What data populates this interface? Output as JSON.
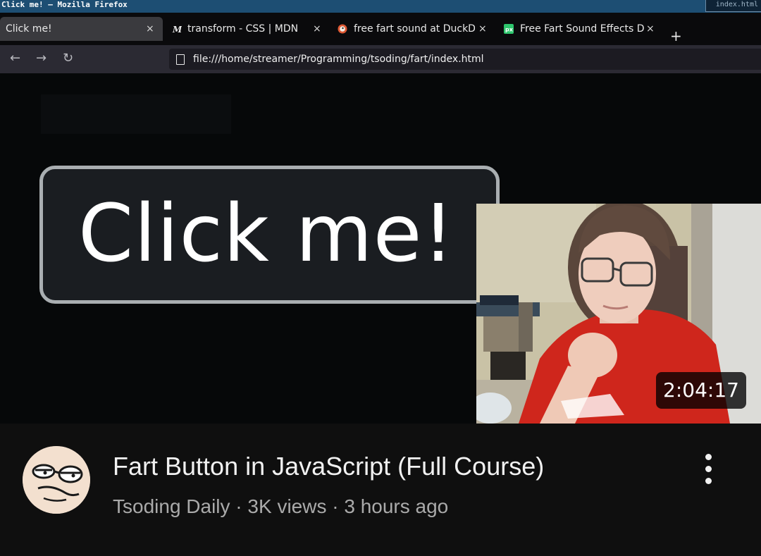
{
  "os": {
    "window_title": "Click me! — Mozilla Firefox",
    "right_snippet": "index.html"
  },
  "browser": {
    "tabs": [
      {
        "label": "Click me!",
        "active": true,
        "icon": "none"
      },
      {
        "label": "transform - CSS | MDN",
        "active": false,
        "icon": "mdn-logo-icon"
      },
      {
        "label": "free fart sound at DuckD",
        "active": false,
        "icon": "duckduckgo-icon"
      },
      {
        "label": "Free Fart Sound Effects D",
        "active": false,
        "icon": "pixabay-icon"
      }
    ],
    "close_glyph": "×",
    "new_tab_glyph": "+",
    "url": "file:///home/streamer/Programming/tsoding/fart/index.html"
  },
  "page": {
    "button_label": "Click me!"
  },
  "video": {
    "duration": "2:04:17",
    "title": "Fart Button in JavaScript (Full Course)",
    "channel": "Tsoding Daily",
    "views": "3K views",
    "age": "3 hours ago",
    "separator": " · "
  },
  "colors": {
    "os_titlebar": "#1d4e73",
    "browser_toolbar": "#2b2a33",
    "background": "#0f0f0f",
    "title_text": "#f1f1f1",
    "meta_text": "#aaaaaa"
  }
}
